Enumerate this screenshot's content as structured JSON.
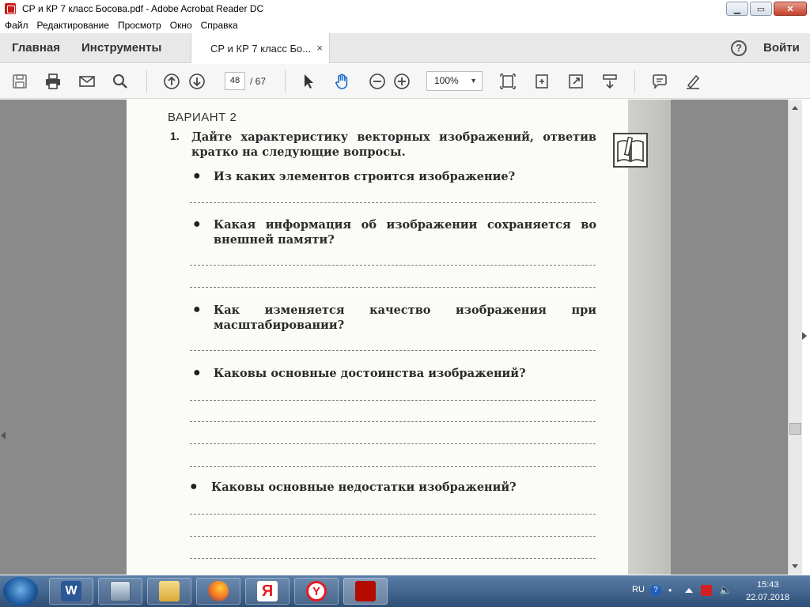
{
  "window": {
    "title": "СР и КР 7 класс Босова.pdf - Adobe Acrobat Reader DC",
    "minimize": "▁",
    "maximize": "▭",
    "close": "✕"
  },
  "menu": [
    "Файл",
    "Редактирование",
    "Просмотр",
    "Окно",
    "Справка"
  ],
  "nav": {
    "home": "Главная",
    "tools": "Инструменты",
    "doc_tab": "СР и КР 7 класс Бо...",
    "tab_close": "×",
    "help": "?",
    "signin": "Войти"
  },
  "toolbar": {
    "page_current": "48",
    "page_total": "/  67",
    "zoom": "100%",
    "icons": [
      "save-icon",
      "print-icon",
      "email-icon",
      "search-icon",
      "prev-page-icon",
      "next-page-icon",
      "select-cursor-icon",
      "hand-tool-icon",
      "zoom-out-icon",
      "zoom-in-icon",
      "fit-page-icon",
      "page-rotate-icon",
      "fullscreen-icon",
      "scroll-mode-icon",
      "comment-icon",
      "highlight-icon"
    ]
  },
  "document": {
    "variant": "ВАРИАНТ 2",
    "q_number": "1.",
    "q_text": "Дайте характеристику векторных изображений, ответив кратко на следующие вопросы.",
    "bullets": [
      "Из каких элементов строится изображение?",
      "Какая информация об изображении сохраняется во внешней памяти?",
      "Как изменяется качество изображения при масштабировании?",
      "Каковы основные достоинства изображений?",
      "Каковы основные недостатки изображений?"
    ]
  },
  "taskbar": {
    "apps": [
      "word-icon",
      "computer-icon",
      "explorer-icon",
      "firefox-icon",
      "yandex-icon",
      "yandex-browser-icon",
      "acrobat-icon"
    ],
    "lang": "RU",
    "time": "15:43",
    "date": "22.07.2018"
  }
}
